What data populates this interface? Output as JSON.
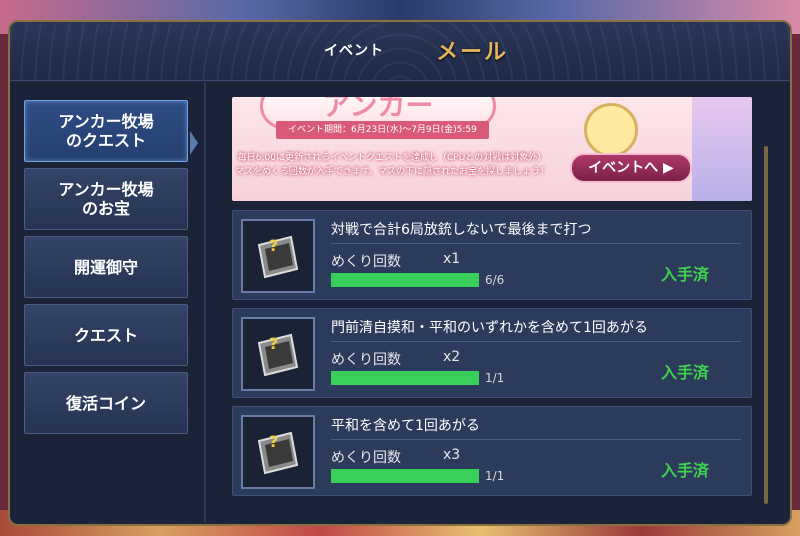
{
  "header": {
    "tab_event": "イベント",
    "tab_mail": "メール"
  },
  "sidebar": {
    "items": [
      {
        "label_line1": "アンカー牧場",
        "label_line2": "のクエスト",
        "active": true
      },
      {
        "label_line1": "アンカー牧場",
        "label_line2": "のお宝",
        "active": false
      },
      {
        "label_line1": "開運御守",
        "label_line2": "",
        "active": false
      },
      {
        "label_line1": "クエスト",
        "label_line2": "",
        "active": false
      },
      {
        "label_line1": "復活コイン",
        "label_line2": "",
        "active": false
      }
    ]
  },
  "banner": {
    "title": "アンカー",
    "period": "イベント期間：6月23日(水)～7月9日(金)5:59",
    "desc_line1": "毎日6:00に更新されるイベントクエストを達成し（CPUとの対戦は対象外）",
    "desc_line2": "マスをめくる回数が入手できます。マスの下に隠されたお宝を探しましょう！",
    "button_label": "イベントへ ▶"
  },
  "quests": [
    {
      "title": "対戦で合計6局放銃しないで最後まで打つ",
      "reward_label": "めくり回数",
      "multiplier": "x1",
      "progress_text": "6/6",
      "progress_fraction": 1.0,
      "status": "入手済"
    },
    {
      "title": "門前清自摸和・平和のいずれかを含めて1回あがる",
      "reward_label": "めくり回数",
      "multiplier": "x2",
      "progress_text": "1/1",
      "progress_fraction": 1.0,
      "status": "入手済"
    },
    {
      "title": "平和を含めて1回あがる",
      "reward_label": "めくり回数",
      "multiplier": "x3",
      "progress_text": "1/1",
      "progress_fraction": 1.0,
      "status": "入手済"
    }
  ],
  "colors": {
    "accent_gold": "#e6b45a",
    "progress_green": "#38cf5a",
    "status_green": "#3ed14e",
    "active_border": "#6ea2e0"
  }
}
